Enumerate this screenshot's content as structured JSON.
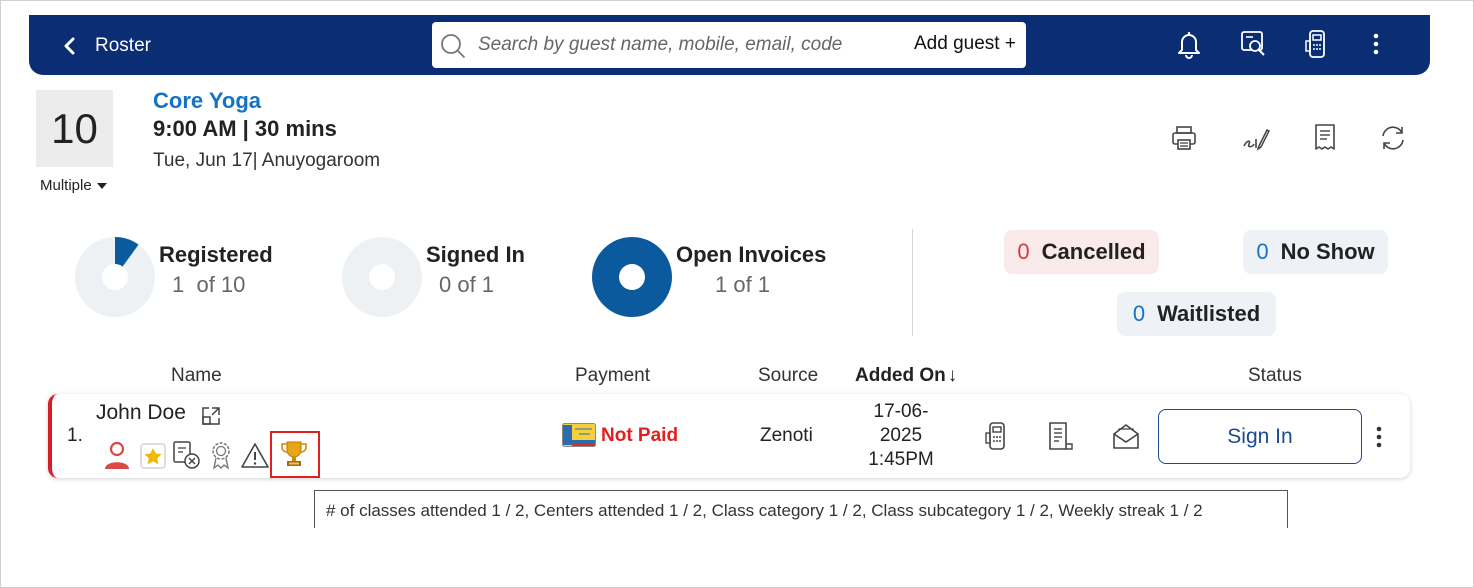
{
  "topbar": {
    "back_label": "Roster",
    "search_placeholder": "Search by guest name, mobile, email, code",
    "add_guest_label": "Add guest +",
    "icons": [
      "bell-icon",
      "search-document-icon",
      "card-terminal-icon",
      "more-vertical-icon"
    ]
  },
  "class_info": {
    "capacity": "10",
    "multiple_label": "Multiple",
    "name": "Core Yoga",
    "time": "9:00 AM | 30 mins",
    "date_room": "Tue, Jun 17| Anuyogaroom",
    "actions": [
      "print-icon",
      "signature-icon",
      "receipt-icon",
      "refresh-icon"
    ]
  },
  "stats": {
    "registered": {
      "title": "Registered",
      "value": "1  of 10",
      "fraction": 0.1
    },
    "signed_in": {
      "title": "Signed In",
      "value": "0 of 1",
      "fraction": 0
    },
    "open_invoices": {
      "title": "Open Invoices",
      "value": "1 of 1",
      "fraction": 1
    },
    "cancelled": {
      "count": "0",
      "label": "Cancelled"
    },
    "no_show": {
      "count": "0",
      "label": "No Show"
    },
    "waitlisted": {
      "count": "0",
      "label": "Waitlisted"
    }
  },
  "table": {
    "headers": {
      "name": "Name",
      "payment": "Payment",
      "source": "Source",
      "added_on": "Added On",
      "status": "Status"
    },
    "rows": [
      {
        "index": "1.",
        "name": "John Doe",
        "payment_status": "Not Paid",
        "source": "Zenoti",
        "added_on_date": "17-06-",
        "added_on_year": "2025",
        "added_on_time": "1:45PM",
        "sign_in_label": "Sign In",
        "status_icons": [
          "person-icon",
          "star-icon",
          "form-cancelled-icon",
          "badge-icon",
          "warning-icon",
          "trophy-icon"
        ]
      }
    ]
  },
  "tooltip": {
    "text": "# of classes attended 1 / 2, Centers attended 1 / 2, Class category 1 / 2, Class subcategory 1 / 2, Weekly streak 1 / 2"
  },
  "colors": {
    "topbar": "#0a2d74",
    "accent_blue": "#1673c4",
    "donut_fill": "#0c5a9e",
    "donut_track": "#eef1f4",
    "not_paid": "#e02020",
    "row_flag": "#d71e28"
  }
}
